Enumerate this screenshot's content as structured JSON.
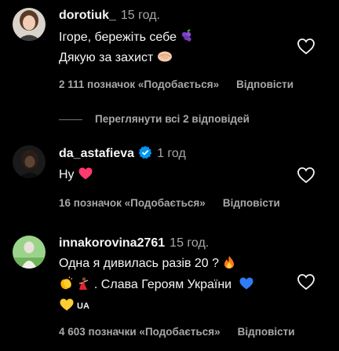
{
  "comments": [
    {
      "username": "dorotiuk_",
      "time": "15 год.",
      "lines": [
        "Ігоре, бережіть себе",
        "Дякую за захист"
      ],
      "likes": "2 111 позначок «Подобається»",
      "reply": "Відповісти",
      "verified": false
    },
    {
      "username": "da_astafieva",
      "time": "1 год",
      "lines": [
        "Ну"
      ],
      "likes": "16 позначок «Подобається»",
      "reply": "Відповісти",
      "verified": true
    },
    {
      "username": "innakorovina2761",
      "time": "15 год.",
      "lines": [
        "Одна я дивилась разів 20 ?",
        ". Слава Героям України",
        "UA"
      ],
      "likes": "4 603 позначки «Подобається»",
      "reply": "Відповісти",
      "verified": false
    }
  ],
  "view_replies": "Переглянути всі 2 відповідей",
  "icons": {
    "like": "heart-outline-icon",
    "verified": "verified-badge-icon"
  },
  "colors": {
    "background": "#000000",
    "text": "#f5f5f5",
    "secondary": "#a8a8a8",
    "verified": "#0095f6",
    "heart": "#ff3a6e"
  }
}
